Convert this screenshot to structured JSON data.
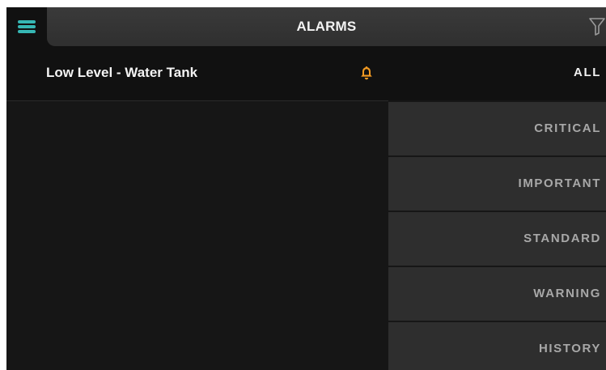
{
  "header": {
    "title": "ALARMS",
    "menu_icon": "hamburger-menu-icon",
    "filter_icon": "filter-icon"
  },
  "alarms": [
    {
      "label": "Low Level - Water Tank",
      "icon": "bell-icon"
    }
  ],
  "filters": [
    {
      "label": "ALL",
      "active": true
    },
    {
      "label": "CRITICAL",
      "active": false
    },
    {
      "label": "IMPORTANT",
      "active": false
    },
    {
      "label": "STANDARD",
      "active": false
    },
    {
      "label": "WARNING",
      "active": false
    },
    {
      "label": "HISTORY",
      "active": false
    }
  ],
  "colors": {
    "accent_menu": "#36b7b4",
    "bell": "#f29a22",
    "background": "#161616",
    "header": "#333333",
    "filter_bg": "#2e2e2e"
  }
}
